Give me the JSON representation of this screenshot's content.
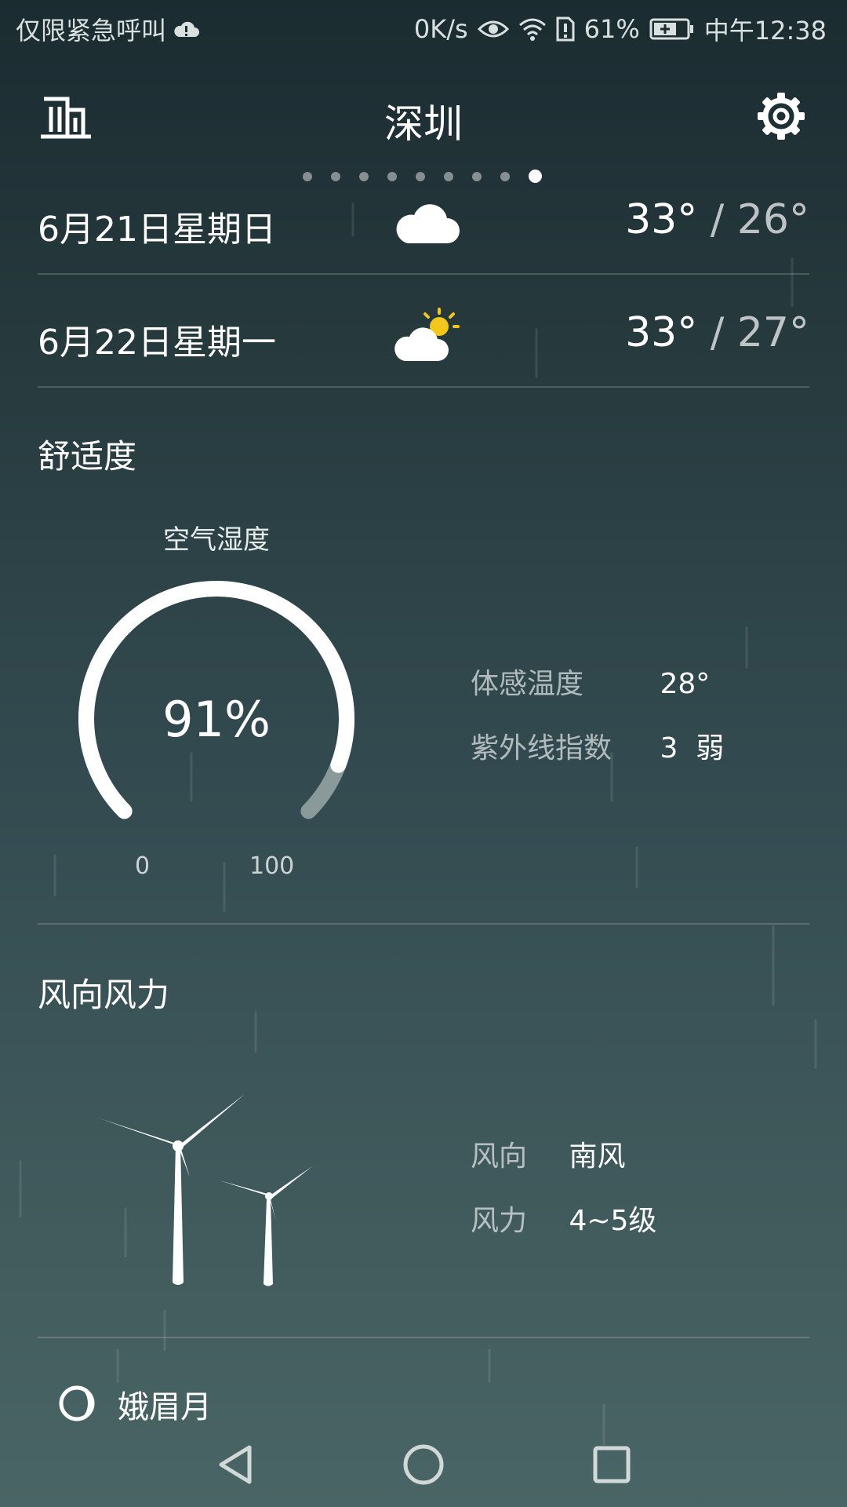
{
  "status_bar": {
    "carrier": "仅限紧急呼叫",
    "net_speed": "0K/s",
    "battery": "61%",
    "time": "中午12:38"
  },
  "header": {
    "city": "深圳",
    "page_count": 9,
    "active_page": 9
  },
  "forecast": [
    {
      "date": "6月21日星期日",
      "icon": "cloudy-icon",
      "high": "33°",
      "separator": "/",
      "low": "26°"
    },
    {
      "date": "6月22日星期一",
      "icon": "partly-cloudy-icon",
      "high": "33°",
      "separator": "/",
      "low": "27°"
    }
  ],
  "comfort": {
    "title": "舒适度",
    "humidity_label": "空气湿度",
    "humidity_value": "91%",
    "humidity_fraction": 0.91,
    "scale_min": "0",
    "scale_max": "100",
    "feels_like_label": "体感温度",
    "feels_like_value": "28°",
    "uv_label": "紫外线指数",
    "uv_value": "3  弱"
  },
  "wind": {
    "title": "风向风力",
    "direction_label": "风向",
    "direction_value": "南风",
    "force_label": "风力",
    "force_value": "4~5级"
  },
  "moon": {
    "phase": "娥眉月"
  },
  "colors": {
    "bg_top": "#1b2c31",
    "bg_bottom": "#4a6565",
    "gauge_track": "#ffffff",
    "gauge_rest": "#8a9a9a",
    "sun": "#f2c61a"
  }
}
